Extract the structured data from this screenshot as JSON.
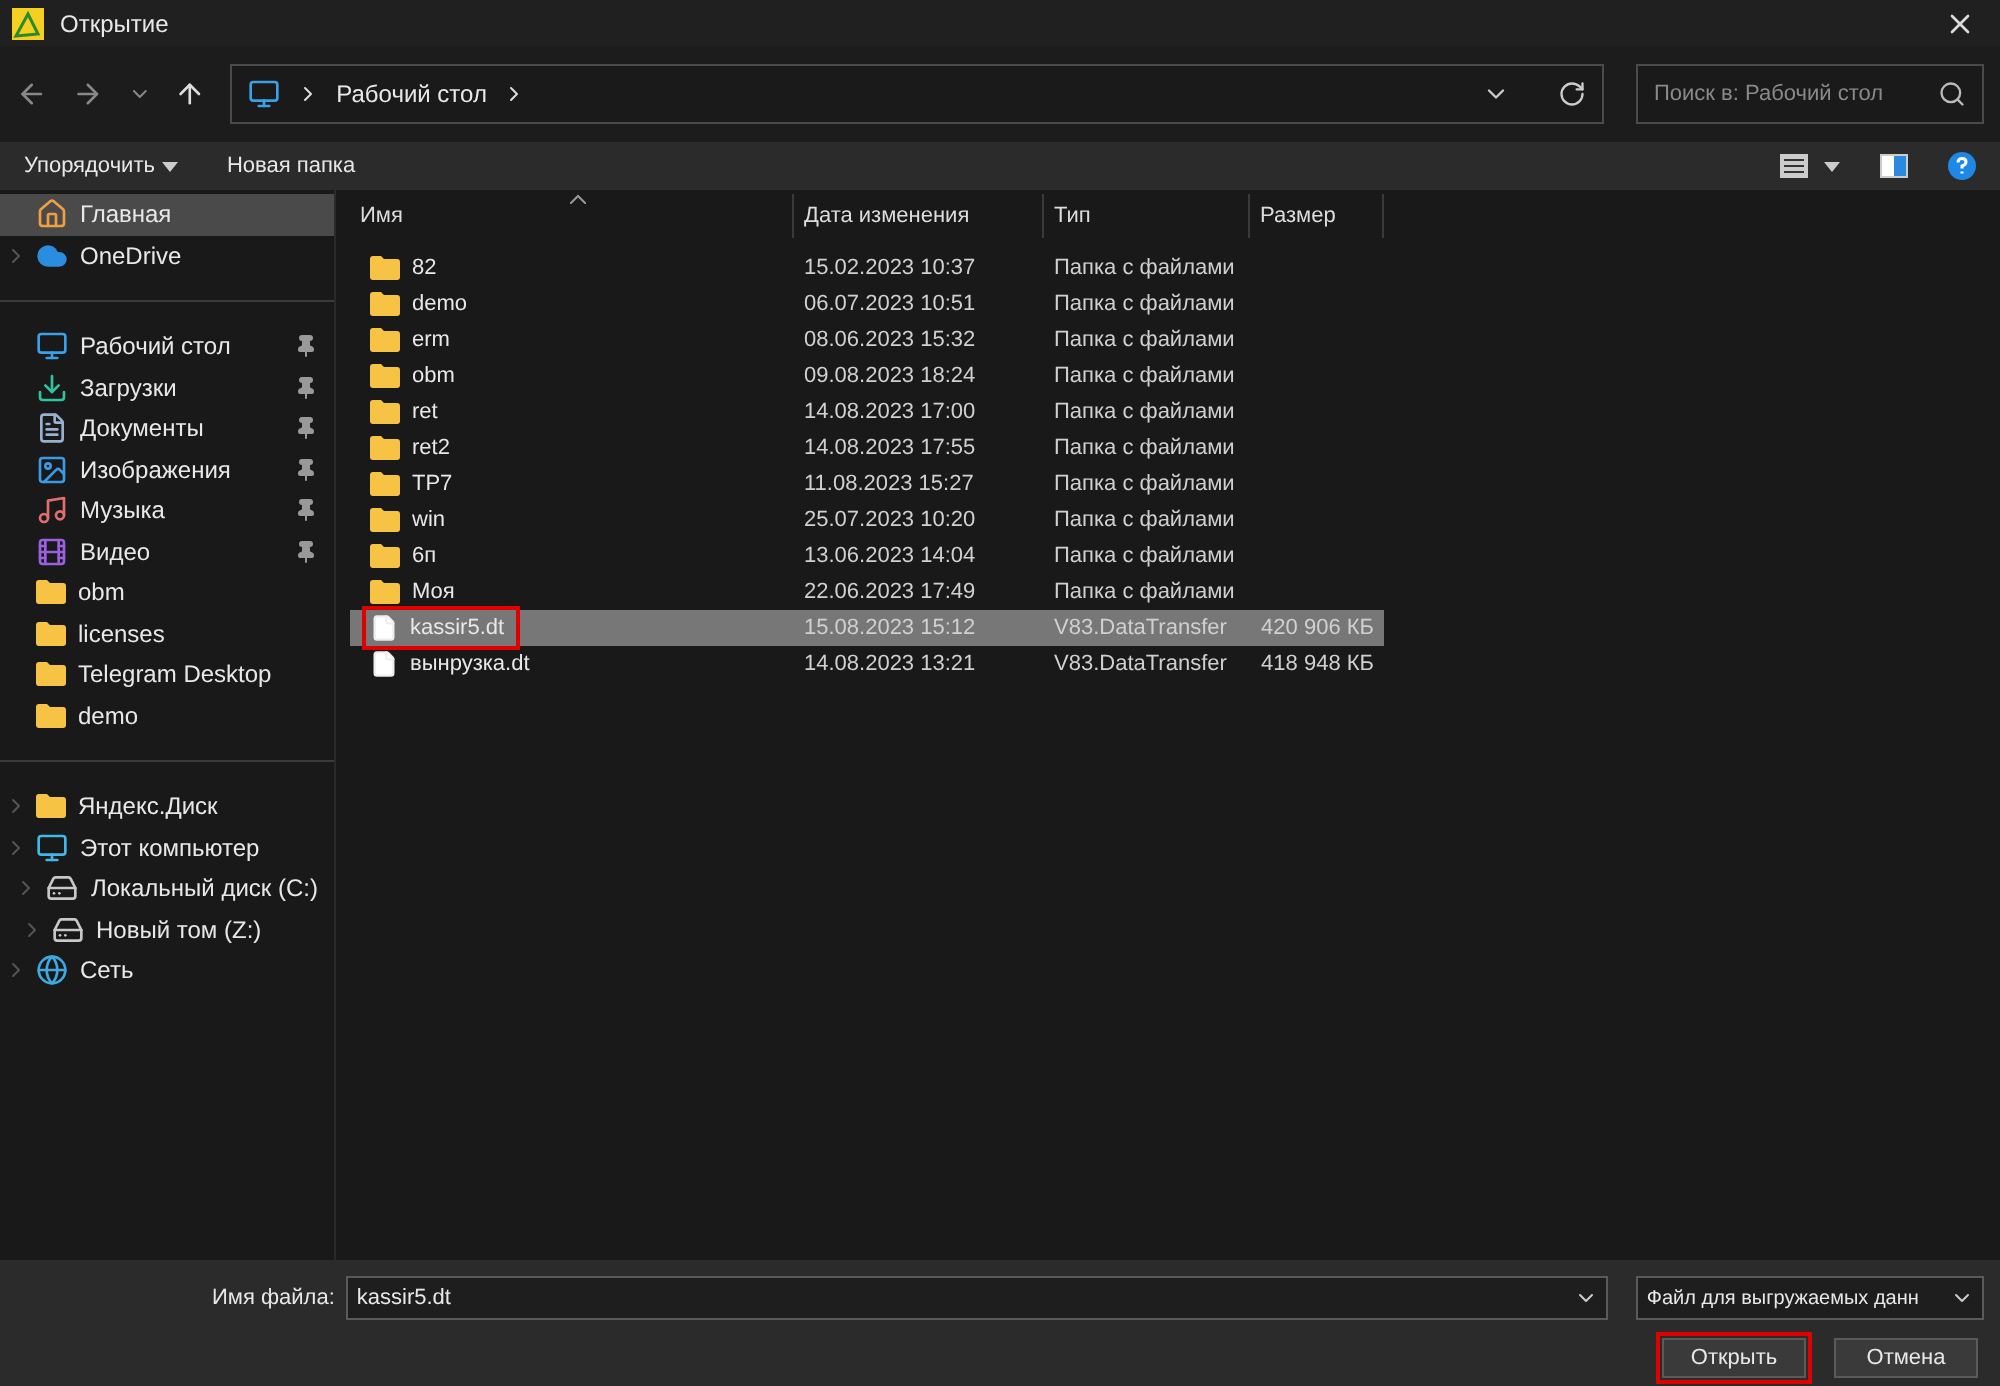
{
  "window": {
    "title": "Открытие"
  },
  "address": {
    "path": [
      "Рабочий стол"
    ]
  },
  "search": {
    "placeholder": "Поиск в: Рабочий стол"
  },
  "toolbar": {
    "organize": "Упорядочить",
    "new_folder": "Новая папка"
  },
  "sidebar": {
    "groups": [
      [
        {
          "label": "Главная",
          "kind": "home",
          "selected": true,
          "expander": false,
          "pinned": false
        },
        {
          "label": "OneDrive",
          "kind": "cloud",
          "selected": false,
          "expander": true,
          "pinned": false
        }
      ],
      [
        {
          "label": "Рабочий стол",
          "kind": "desktop",
          "selected": false,
          "expander": false,
          "pinned": true
        },
        {
          "label": "Загрузки",
          "kind": "downloads",
          "selected": false,
          "expander": false,
          "pinned": true
        },
        {
          "label": "Документы",
          "kind": "documents",
          "selected": false,
          "expander": false,
          "pinned": true
        },
        {
          "label": "Изображения",
          "kind": "pictures",
          "selected": false,
          "expander": false,
          "pinned": true
        },
        {
          "label": "Музыка",
          "kind": "music",
          "selected": false,
          "expander": false,
          "pinned": true
        },
        {
          "label": "Видео",
          "kind": "video",
          "selected": false,
          "expander": false,
          "pinned": true
        },
        {
          "label": "obm",
          "kind": "folder",
          "selected": false,
          "expander": false,
          "pinned": false
        },
        {
          "label": "licenses",
          "kind": "folder",
          "selected": false,
          "expander": false,
          "pinned": false
        },
        {
          "label": "Telegram Desktop",
          "kind": "folder",
          "selected": false,
          "expander": false,
          "pinned": false
        },
        {
          "label": "demo",
          "kind": "folder",
          "selected": false,
          "expander": false,
          "pinned": false
        }
      ],
      [
        {
          "label": "Яндекс.Диск",
          "kind": "folder",
          "selected": false,
          "expander": true,
          "pinned": false
        },
        {
          "label": "Этот компьютер",
          "kind": "computer",
          "selected": false,
          "expander": true,
          "pinned": false,
          "children": [
            {
              "label": "Локальный диск (C:)",
              "kind": "drive",
              "selected": false,
              "expander": true,
              "pinned": false
            },
            {
              "label": "Новый том (Z:)",
              "kind": "drive",
              "selected": false,
              "expander": true,
              "pinned": false
            }
          ]
        },
        {
          "label": "Сеть",
          "kind": "network",
          "selected": false,
          "expander": true,
          "pinned": false
        }
      ]
    ]
  },
  "table": {
    "columns": [
      "Имя",
      "Дата изменения",
      "Тип",
      "Размер"
    ],
    "rows": [
      {
        "kind": "folder",
        "name": "82",
        "date": "15.02.2023 10:37",
        "type": "Папка с файлами",
        "selected": false,
        "highlighted": false
      },
      {
        "kind": "folder",
        "name": "demo",
        "date": "06.07.2023 10:51",
        "type": "Папка с файлами",
        "selected": false,
        "highlighted": false
      },
      {
        "kind": "folder",
        "name": "erm",
        "date": "08.06.2023 15:32",
        "type": "Папка с файлами",
        "selected": false,
        "highlighted": false
      },
      {
        "kind": "folder",
        "name": "obm",
        "date": "09.08.2023 18:24",
        "type": "Папка с файлами",
        "selected": false,
        "highlighted": false
      },
      {
        "kind": "folder",
        "name": "ret",
        "date": "14.08.2023 17:00",
        "type": "Папка с файлами",
        "selected": false,
        "highlighted": false
      },
      {
        "kind": "folder",
        "name": "ret2",
        "date": "14.08.2023 17:55",
        "type": "Папка с файлами",
        "selected": false,
        "highlighted": false
      },
      {
        "kind": "folder",
        "name": "TP7",
        "date": "11.08.2023 15:27",
        "type": "Папка с файлами",
        "selected": false,
        "highlighted": false
      },
      {
        "kind": "folder",
        "name": "win",
        "date": "25.07.2023 10:20",
        "type": "Папка с файлами",
        "selected": false,
        "highlighted": false
      },
      {
        "kind": "folder",
        "name": "6п",
        "date": "13.06.2023 14:04",
        "type": "Папка с файлами",
        "selected": false,
        "highlighted": false
      },
      {
        "kind": "folder",
        "name": "Моя",
        "date": "22.06.2023 17:49",
        "type": "Папка с файлами",
        "selected": false,
        "highlighted": false
      },
      {
        "kind": "file",
        "name": "kassir5.dt",
        "date": "15.08.2023 15:12",
        "type": "V83.DataTransfer",
        "size": "420 906 КБ",
        "selected": true,
        "highlighted": true
      },
      {
        "kind": "file",
        "name": "вынрузка.dt",
        "date": "14.08.2023 13:21",
        "type": "V83.DataTransfer",
        "size": "418 948 КБ",
        "selected": false,
        "highlighted": false
      }
    ]
  },
  "footer": {
    "filename_label": "Имя файла:",
    "filename": "kassir5.dt",
    "filter": "Файл для выгружаемых данн",
    "open": {
      "label": "Открыть",
      "highlighted": true
    },
    "cancel": {
      "label": "Отмена",
      "highlighted": false
    }
  }
}
